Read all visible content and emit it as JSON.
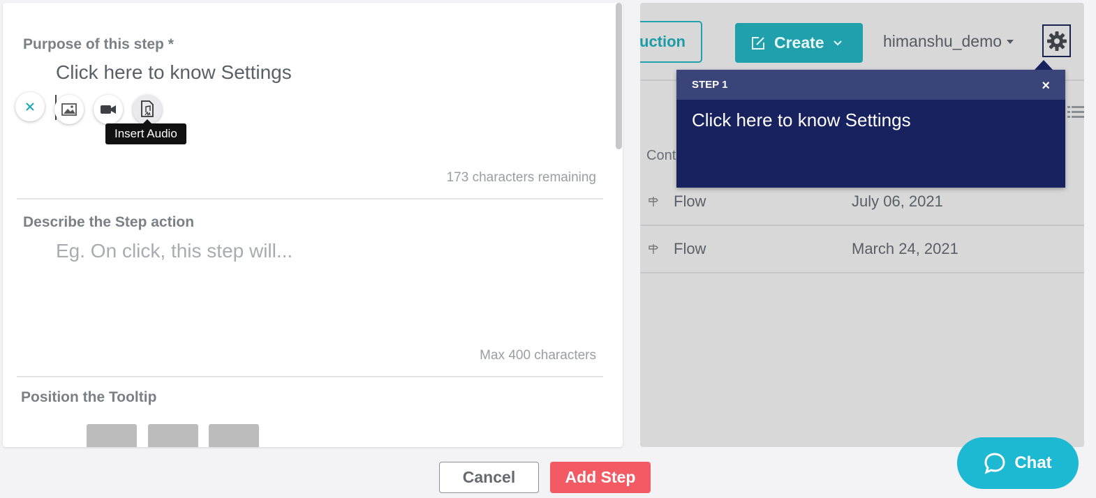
{
  "editor": {
    "purpose_label": "Purpose of this step *",
    "purpose_value": "Click here to know Settings",
    "tooltip_text": "Insert Audio",
    "purpose_counter": "173 characters remaining",
    "describe_label": "Describe the Step action",
    "describe_placeholder": "Eg. On click, this step will...",
    "describe_counter": "Max 400 characters",
    "position_label": "Position the Tooltip"
  },
  "app": {
    "partial_button": "uction",
    "create_label": "Create",
    "username": "himanshu_demo",
    "column_header": "Cont",
    "rows": [
      {
        "type": "Flow",
        "date": "July 06, 2021"
      },
      {
        "type": "Flow",
        "date": "March 24, 2021"
      }
    ]
  },
  "step_popup": {
    "header": "STEP 1",
    "close": "×",
    "body": "Click here to know Settings"
  },
  "footer": {
    "cancel_label": "Cancel",
    "add_label": "Add Step"
  },
  "chat": {
    "label": "Chat"
  },
  "colors": {
    "accent_teal": "#20a0ab",
    "step_bg": "#17225e",
    "add_step": "#f35b64",
    "chat": "#1db8d2"
  }
}
